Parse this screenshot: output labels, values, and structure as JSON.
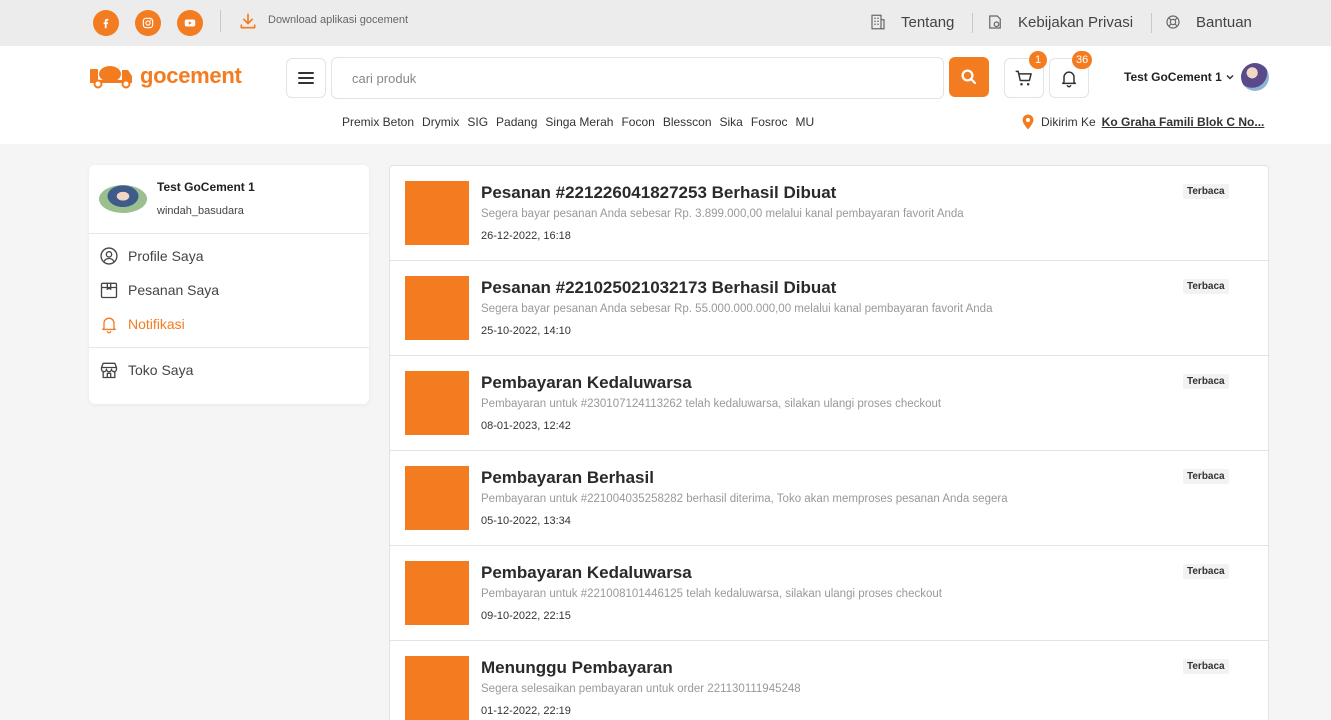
{
  "topbar": {
    "social": [
      {
        "name": "facebook-icon"
      },
      {
        "name": "instagram-icon"
      },
      {
        "name": "youtube-icon"
      }
    ],
    "download_text": "Download aplikasi gocement",
    "links": {
      "about": "Tentang",
      "privacy": "Kebijakan Privasi",
      "help": "Bantuan"
    }
  },
  "header": {
    "logo": {
      "go": "go",
      "cement": "cement"
    },
    "search": {
      "placeholder": "cari produk",
      "value": ""
    },
    "cart_badge": "1",
    "notif_badge": "36",
    "user_name": "Test GoCement 1",
    "categories": [
      "Premix Beton",
      "Drymix",
      "SIG",
      "Padang",
      "Singa Merah",
      "Focon",
      "Blesscon",
      "Sika",
      "Fosroc",
      "MU"
    ],
    "ship_label": "Dikirim Ke",
    "ship_address": "Ko Graha Famili Blok C No..."
  },
  "sidebar": {
    "name": "Test GoCement 1",
    "username": "windah_basudara",
    "items": {
      "profile": "Profile Saya",
      "orders": "Pesanan Saya",
      "notif": "Notifikasi",
      "shop": "Toko Saya"
    }
  },
  "notifications": [
    {
      "title": "Pesanan #221226041827253 Berhasil Dibuat",
      "desc": "Segera bayar pesanan Anda sebesar Rp. 3.899.000,00 melalui kanal pembayaran favorit Anda",
      "date": "26-12-2022, 16:18",
      "status": "Terbaca"
    },
    {
      "title": "Pesanan #221025021032173 Berhasil Dibuat",
      "desc": "Segera bayar pesanan Anda sebesar Rp. 55.000.000.000,00 melalui kanal pembayaran favorit Anda",
      "date": "25-10-2022, 14:10",
      "status": "Terbaca"
    },
    {
      "title": "Pembayaran Kedaluwarsa",
      "desc": "Pembayaran untuk #230107124113262 telah kedaluwarsa, silakan ulangi proses checkout",
      "date": "08-01-2023, 12:42",
      "status": "Terbaca"
    },
    {
      "title": "Pembayaran Berhasil",
      "desc": "Pembayaran untuk #221004035258282 berhasil diterima, Toko akan memproses pesanan Anda segera",
      "date": "05-10-2022, 13:34",
      "status": "Terbaca"
    },
    {
      "title": "Pembayaran Kedaluwarsa",
      "desc": "Pembayaran untuk #221008101446125 telah kedaluwarsa, silakan ulangi proses checkout",
      "date": "09-10-2022, 22:15",
      "status": "Terbaca"
    },
    {
      "title": "Menunggu Pembayaran",
      "desc": "Segera selesaikan pembayaran untuk order 221130111945248",
      "date": "01-12-2022, 22:19",
      "status": "Terbaca"
    }
  ],
  "colors": {
    "accent": "#f47c20"
  }
}
